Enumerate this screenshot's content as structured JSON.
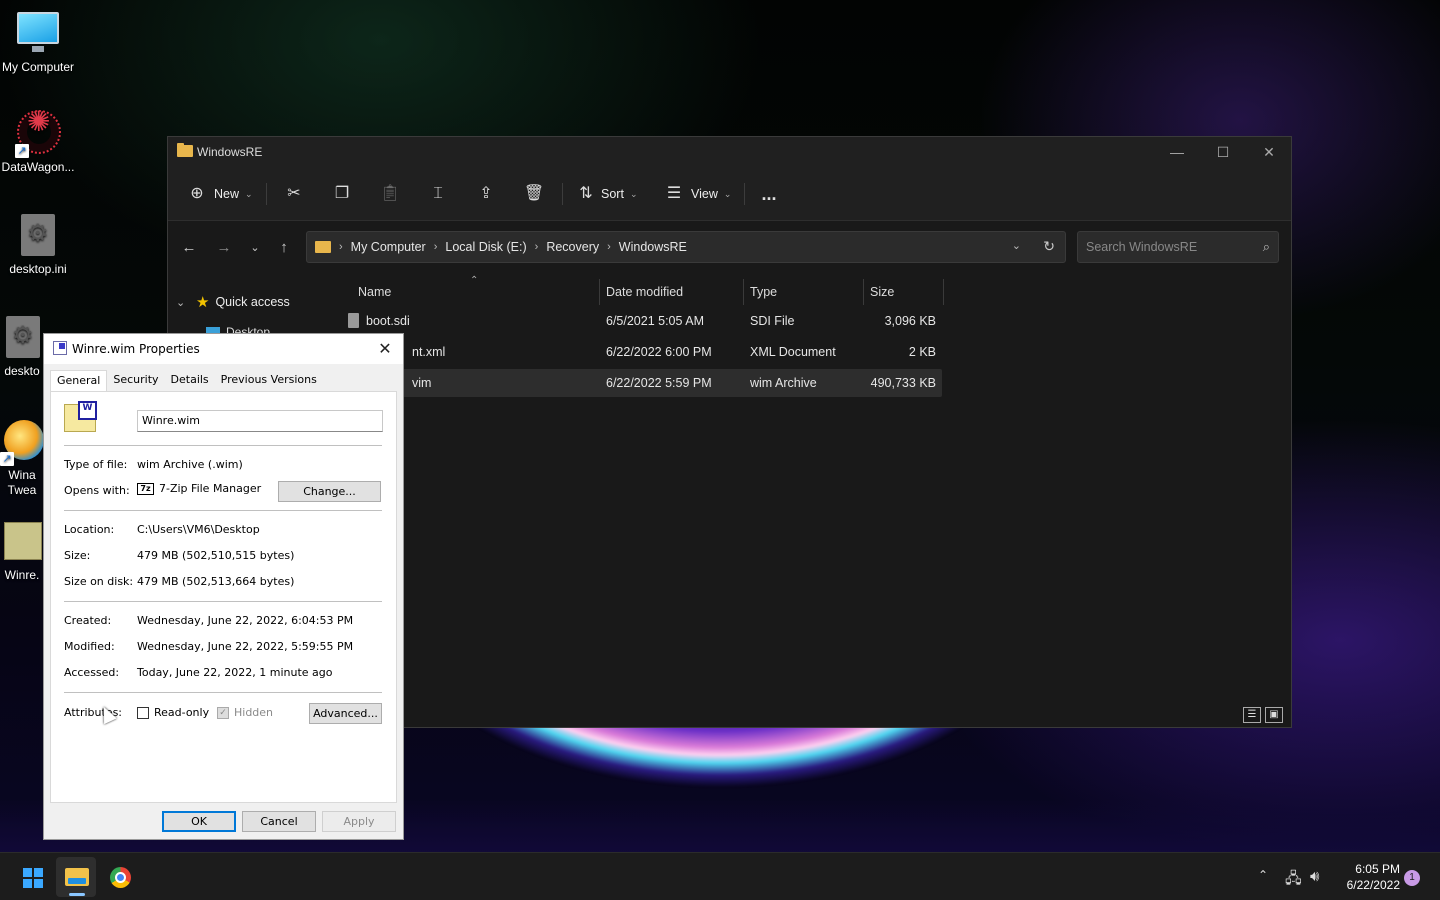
{
  "desktop": {
    "icons": [
      {
        "label": "My Computer"
      },
      {
        "label": "DataWagon..."
      },
      {
        "label": "desktop.ini"
      },
      {
        "label": "deskto"
      },
      {
        "label": "Wina Twea"
      },
      {
        "label": "Winre."
      }
    ]
  },
  "explorer": {
    "title": "WindowsRE",
    "toolbar": {
      "new_label": "New",
      "sort_label": "Sort",
      "view_label": "View",
      "more_label": "..."
    },
    "breadcrumb": [
      "My Computer",
      "Local Disk (E:)",
      "Recovery",
      "WindowsRE"
    ],
    "search_placeholder": "Search WindowsRE",
    "nav": {
      "quick_access": "Quick access",
      "partial_item": "Desktop"
    },
    "columns": [
      "Name",
      "Date modified",
      "Type",
      "Size"
    ],
    "files": [
      {
        "name": "boot.sdi",
        "date": "6/5/2021 5:05 AM",
        "type": "SDI File",
        "size": "3,096 KB"
      },
      {
        "name": "nt.xml",
        "date": "6/22/2022 6:00 PM",
        "type": "XML Document",
        "size": "2 KB"
      },
      {
        "name": "vim",
        "date": "6/22/2022 5:59 PM",
        "type": "wim Archive",
        "size": "490,733 KB"
      }
    ]
  },
  "properties": {
    "title": "Winre.wim Properties",
    "tabs": [
      "General",
      "Security",
      "Details",
      "Previous Versions"
    ],
    "file_name": "Winre.wim",
    "type_label": "Type of file:",
    "type_value": "wim Archive (.wim)",
    "opens_label": "Opens with:",
    "opens_icon_text": "7z",
    "opens_value": "7-Zip File Manager",
    "change_button": "Change...",
    "location_label": "Location:",
    "location_value": "C:\\Users\\VM6\\Desktop",
    "size_label": "Size:",
    "size_value": "479 MB (502,510,515 bytes)",
    "size_disk_label": "Size on disk:",
    "size_disk_value": "479 MB (502,513,664 bytes)",
    "created_label": "Created:",
    "created_value": "Wednesday, June 22, 2022, 6:04:53 PM",
    "modified_label": "Modified:",
    "modified_value": "Wednesday, June 22, 2022, 5:59:55 PM",
    "accessed_label": "Accessed:",
    "accessed_value": "Today, June 22, 2022, 1 minute ago",
    "attributes_label": "Attributes:",
    "readonly_label": "Read-only",
    "hidden_label": "Hidden",
    "advanced_button": "Advanced...",
    "ok_button": "OK",
    "cancel_button": "Cancel",
    "apply_button": "Apply"
  },
  "taskbar": {
    "time": "6:05 PM",
    "date": "6/22/2022",
    "notification_count": "1"
  }
}
